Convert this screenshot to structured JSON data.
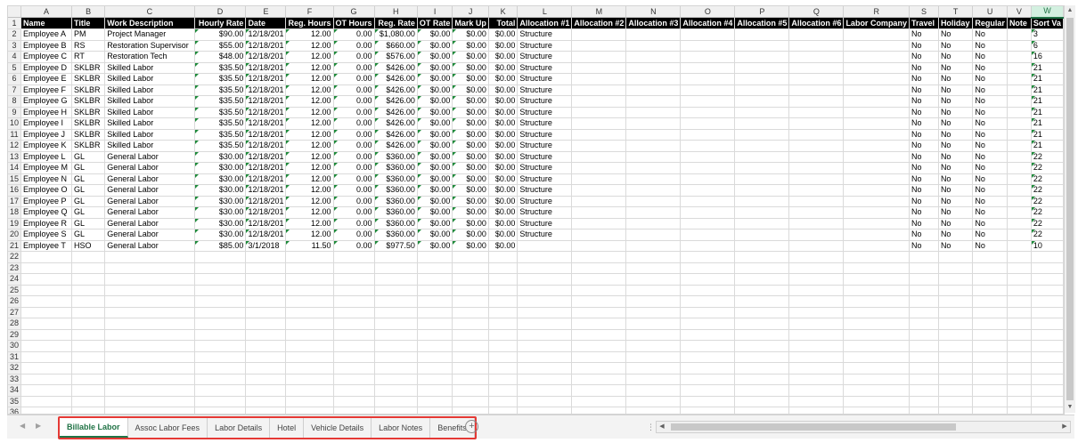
{
  "columns": [
    "A",
    "B",
    "C",
    "D",
    "E",
    "F",
    "G",
    "H",
    "I",
    "J",
    "K",
    "L",
    "M",
    "N",
    "O",
    "P",
    "Q",
    "R",
    "S",
    "T",
    "U",
    "V",
    "W"
  ],
  "selected_column": "W",
  "headers": [
    "Name",
    "Title",
    "Work Description",
    "Hourly Rate",
    "Date",
    "Reg. Hours",
    "OT Hours",
    "Reg. Rate",
    "OT Rate",
    "Mark Up",
    "Total",
    "Allocation #1",
    "Allocation #2",
    "Allocation #3",
    "Allocation #4",
    "Allocation #5",
    "Allocation #6",
    "Labor Company",
    "Travel",
    "Holiday",
    "Regular",
    "Note",
    "Sort Va"
  ],
  "rows": [
    [
      "Employee A",
      "PM",
      "Project Manager",
      "$90.00",
      "12/18/201",
      "12.00",
      "0.00",
      "$1,080.00",
      "$0.00",
      "$0.00",
      "$0.00",
      "Structure",
      "",
      "",
      "",
      "",
      "",
      "",
      "No",
      "No",
      "No",
      "",
      "3"
    ],
    [
      "Employee B",
      "RS",
      "Restoration Supervisor",
      "$55.00",
      "12/18/201",
      "12.00",
      "0.00",
      "$660.00",
      "$0.00",
      "$0.00",
      "$0.00",
      "Structure",
      "",
      "",
      "",
      "",
      "",
      "",
      "No",
      "No",
      "No",
      "",
      "6"
    ],
    [
      "Employee C",
      "RT",
      "Restoration Tech",
      "$48.00",
      "12/18/201",
      "12.00",
      "0.00",
      "$576.00",
      "$0.00",
      "$0.00",
      "$0.00",
      "Structure",
      "",
      "",
      "",
      "",
      "",
      "",
      "No",
      "No",
      "No",
      "",
      "16"
    ],
    [
      "Employee D",
      "SKLBR",
      "Skilled Labor",
      "$35.50",
      "12/18/201",
      "12.00",
      "0.00",
      "$426.00",
      "$0.00",
      "$0.00",
      "$0.00",
      "Structure",
      "",
      "",
      "",
      "",
      "",
      "",
      "No",
      "No",
      "No",
      "",
      "21"
    ],
    [
      "Employee E",
      "SKLBR",
      "Skilled Labor",
      "$35.50",
      "12/18/201",
      "12.00",
      "0.00",
      "$426.00",
      "$0.00",
      "$0.00",
      "$0.00",
      "Structure",
      "",
      "",
      "",
      "",
      "",
      "",
      "No",
      "No",
      "No",
      "",
      "21"
    ],
    [
      "Employee F",
      "SKLBR",
      "Skilled Labor",
      "$35.50",
      "12/18/201",
      "12.00",
      "0.00",
      "$426.00",
      "$0.00",
      "$0.00",
      "$0.00",
      "Structure",
      "",
      "",
      "",
      "",
      "",
      "",
      "No",
      "No",
      "No",
      "",
      "21"
    ],
    [
      "Employee G",
      "SKLBR",
      "Skilled Labor",
      "$35.50",
      "12/18/201",
      "12.00",
      "0.00",
      "$426.00",
      "$0.00",
      "$0.00",
      "$0.00",
      "Structure",
      "",
      "",
      "",
      "",
      "",
      "",
      "No",
      "No",
      "No",
      "",
      "21"
    ],
    [
      "Employee H",
      "SKLBR",
      "Skilled Labor",
      "$35.50",
      "12/18/201",
      "12.00",
      "0.00",
      "$426.00",
      "$0.00",
      "$0.00",
      "$0.00",
      "Structure",
      "",
      "",
      "",
      "",
      "",
      "",
      "No",
      "No",
      "No",
      "",
      "21"
    ],
    [
      "Employee I",
      "SKLBR",
      "Skilled Labor",
      "$35.50",
      "12/18/201",
      "12.00",
      "0.00",
      "$426.00",
      "$0.00",
      "$0.00",
      "$0.00",
      "Structure",
      "",
      "",
      "",
      "",
      "",
      "",
      "No",
      "No",
      "No",
      "",
      "21"
    ],
    [
      "Employee J",
      "SKLBR",
      "Skilled Labor",
      "$35.50",
      "12/18/201",
      "12.00",
      "0.00",
      "$426.00",
      "$0.00",
      "$0.00",
      "$0.00",
      "Structure",
      "",
      "",
      "",
      "",
      "",
      "",
      "No",
      "No",
      "No",
      "",
      "21"
    ],
    [
      "Employee K",
      "SKLBR",
      "Skilled Labor",
      "$35.50",
      "12/18/201",
      "12.00",
      "0.00",
      "$426.00",
      "$0.00",
      "$0.00",
      "$0.00",
      "Structure",
      "",
      "",
      "",
      "",
      "",
      "",
      "No",
      "No",
      "No",
      "",
      "21"
    ],
    [
      "Employee L",
      "GL",
      "General Labor",
      "$30.00",
      "12/18/201",
      "12.00",
      "0.00",
      "$360.00",
      "$0.00",
      "$0.00",
      "$0.00",
      "Structure",
      "",
      "",
      "",
      "",
      "",
      "",
      "No",
      "No",
      "No",
      "",
      "22"
    ],
    [
      "Employee M",
      "GL",
      "General Labor",
      "$30.00",
      "12/18/201",
      "12.00",
      "0.00",
      "$360.00",
      "$0.00",
      "$0.00",
      "$0.00",
      "Structure",
      "",
      "",
      "",
      "",
      "",
      "",
      "No",
      "No",
      "No",
      "",
      "22"
    ],
    [
      "Employee N",
      "GL",
      "General Labor",
      "$30.00",
      "12/18/201",
      "12.00",
      "0.00",
      "$360.00",
      "$0.00",
      "$0.00",
      "$0.00",
      "Structure",
      "",
      "",
      "",
      "",
      "",
      "",
      "No",
      "No",
      "No",
      "",
      "22"
    ],
    [
      "Employee O",
      "GL",
      "General Labor",
      "$30.00",
      "12/18/201",
      "12.00",
      "0.00",
      "$360.00",
      "$0.00",
      "$0.00",
      "$0.00",
      "Structure",
      "",
      "",
      "",
      "",
      "",
      "",
      "No",
      "No",
      "No",
      "",
      "22"
    ],
    [
      "Employee P",
      "GL",
      "General Labor",
      "$30.00",
      "12/18/201",
      "12.00",
      "0.00",
      "$360.00",
      "$0.00",
      "$0.00",
      "$0.00",
      "Structure",
      "",
      "",
      "",
      "",
      "",
      "",
      "No",
      "No",
      "No",
      "",
      "22"
    ],
    [
      "Employee Q",
      "GL",
      "General Labor",
      "$30.00",
      "12/18/201",
      "12.00",
      "0.00",
      "$360.00",
      "$0.00",
      "$0.00",
      "$0.00",
      "Structure",
      "",
      "",
      "",
      "",
      "",
      "",
      "No",
      "No",
      "No",
      "",
      "22"
    ],
    [
      "Employee R",
      "GL",
      "General Labor",
      "$30.00",
      "12/18/201",
      "12.00",
      "0.00",
      "$360.00",
      "$0.00",
      "$0.00",
      "$0.00",
      "Structure",
      "",
      "",
      "",
      "",
      "",
      "",
      "No",
      "No",
      "No",
      "",
      "22"
    ],
    [
      "Employee S",
      "GL",
      "General Labor",
      "$30.00",
      "12/18/201",
      "12.00",
      "0.00",
      "$360.00",
      "$0.00",
      "$0.00",
      "$0.00",
      "Structure",
      "",
      "",
      "",
      "",
      "",
      "",
      "No",
      "No",
      "No",
      "",
      "22"
    ],
    [
      "Employee T",
      "HSO",
      "General Labor",
      "$85.00",
      "3/1/2018",
      "11.50",
      "0.00",
      "$977.50",
      "$0.00",
      "$0.00",
      "$0.00",
      "",
      "",
      "",
      "",
      "",
      "",
      "",
      "No",
      "No",
      "No",
      "",
      "10"
    ]
  ],
  "total_rows_shown": 36,
  "sheet_tabs": [
    "Billable Labor",
    "Assoc Labor Fees",
    "Labor Details",
    "Hotel",
    "Vehicle Details",
    "Labor Notes",
    "Benefits"
  ],
  "active_tab": "Billable Labor",
  "add_sheet_label": "+",
  "icons": {
    "tab_prev": "triangle-left-icon",
    "tab_next": "triangle-right-icon",
    "add_sheet": "plus-circle-icon",
    "scroll_up": "triangle-up-icon",
    "scroll_down": "triangle-down-icon",
    "scroll_left": "triangle-left-icon",
    "scroll_right": "triangle-right-icon"
  },
  "colors": {
    "header_row_bg": "#000000",
    "header_row_text": "#ffffff",
    "accent": "#217346",
    "tab_highlight_border": "#e53935",
    "comment_flag": "#1e8a3a"
  }
}
